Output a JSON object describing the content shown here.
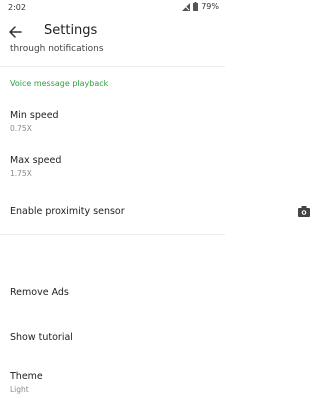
{
  "status_bar": {
    "time": "2:02",
    "battery": "79%",
    "icons": [
      "signal-icon",
      "battery-icon"
    ]
  },
  "app_bar": {
    "back_icon": "arrow-left-icon",
    "title": "Settings"
  },
  "list": {
    "partial_item_text": "through notifications",
    "section_header": "Voice message playback",
    "items": [
      {
        "title": "Min speed",
        "summary": "0.75X"
      },
      {
        "title": "Max speed",
        "summary": "1.75X"
      },
      {
        "title": "Enable proximity sensor",
        "summary": "",
        "icon": "camera-icon"
      },
      {
        "title": "Remove Ads",
        "summary": ""
      },
      {
        "title": "Show tutorial",
        "summary": ""
      },
      {
        "title": "Theme",
        "summary": "Light"
      }
    ]
  },
  "colors": {
    "accent": "#2e9e3e",
    "text_primary": "#222222",
    "text_secondary": "#8a8a8a"
  }
}
